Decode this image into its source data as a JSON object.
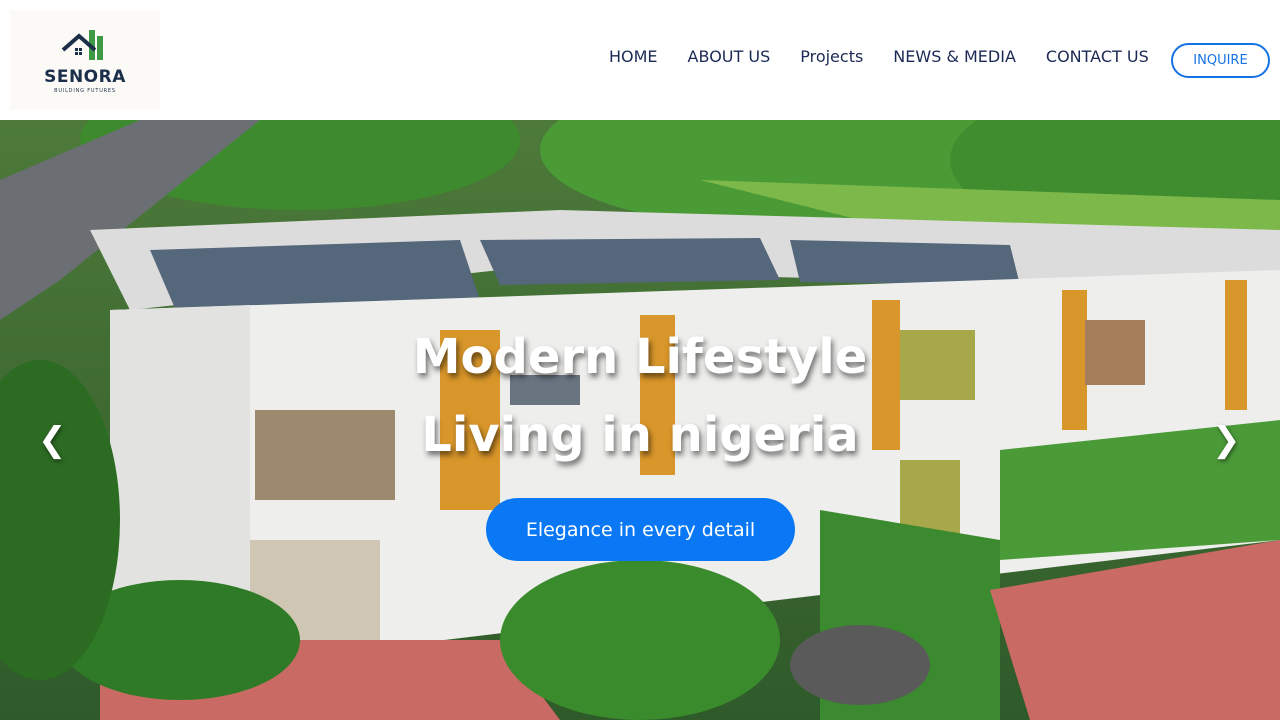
{
  "brand": {
    "name": "SENORA",
    "tagline": "BUILDING FUTURES",
    "colors": {
      "navy": "#1b2e4a",
      "green": "#3f9a46"
    }
  },
  "nav": {
    "items": [
      {
        "label": "HOME"
      },
      {
        "label": "ABOUT US"
      },
      {
        "label": "Projects"
      },
      {
        "label": "NEWS & MEDIA"
      },
      {
        "label": "CONTACT US"
      }
    ],
    "inquire_label": "INQUIRE"
  },
  "hero": {
    "title_line1": "Modern Lifestyle",
    "title_line2": "Living in nigeria",
    "cta_label": "Elegance in every detail",
    "prev_icon": "❮",
    "next_icon": "❯"
  },
  "colors": {
    "accent": "#0a78f4",
    "nav_text": "#1b2a55",
    "inquire_border": "#1473e6"
  }
}
